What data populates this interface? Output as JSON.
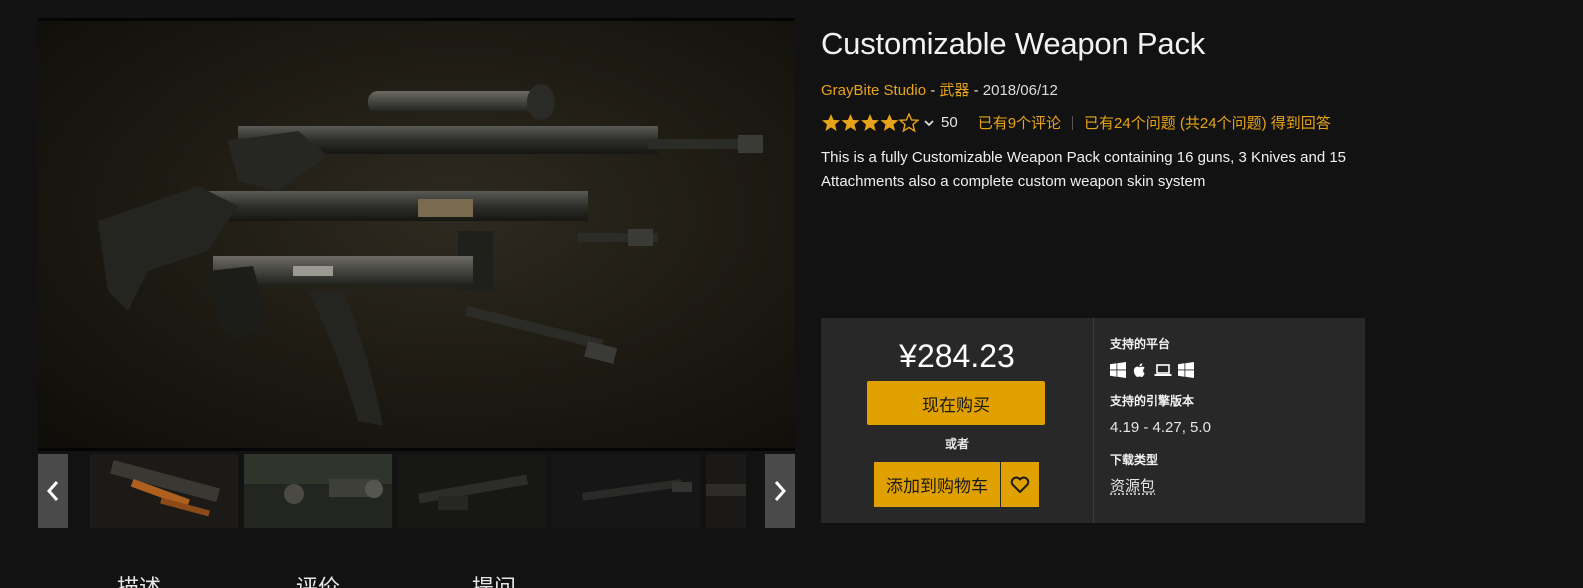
{
  "product": {
    "title": "Customizable Weapon Pack",
    "seller": "GrayBite Studio",
    "meta_sep1": " - ",
    "category": "武器",
    "meta_sep2": " - ",
    "date": "2018/06/12",
    "rating_value": 4.5,
    "rating_count": "50",
    "reviews_link": "已有9个评论",
    "questions_link": "已有24个问题 (共24个问题) 得到回答",
    "description": "This is a fully Customizable Weapon Pack containing 16 guns, 3 Knives and 15 Attachments also a complete custom weapon skin system"
  },
  "gallery": {
    "prev_icon": "chevron-left-icon",
    "next_icon": "chevron-right-icon",
    "thumbnails": [
      "thumb-1",
      "thumb-2",
      "thumb-3",
      "thumb-4",
      "thumb-5"
    ]
  },
  "purchase": {
    "price": "¥284.23",
    "buy_label": "现在购买",
    "or_label": "或者",
    "cart_label": "添加到购物车",
    "wishlist_icon": "heart-icon"
  },
  "specs": {
    "platforms_label": "支持的平台",
    "platform_icons": [
      "windows-icon",
      "apple-icon",
      "linux-laptop-icon",
      "windows-icon"
    ],
    "engine_label": "支持的引擎版本",
    "engine_value": "4.19 - 4.27, 5.0",
    "download_label": "下载类型",
    "download_value": "资源包"
  },
  "tabs": [
    "描述",
    "评价",
    "提问"
  ],
  "colors": {
    "accent": "#e8a418",
    "button": "#e0a100",
    "background": "#121212",
    "panel": "#282828"
  }
}
